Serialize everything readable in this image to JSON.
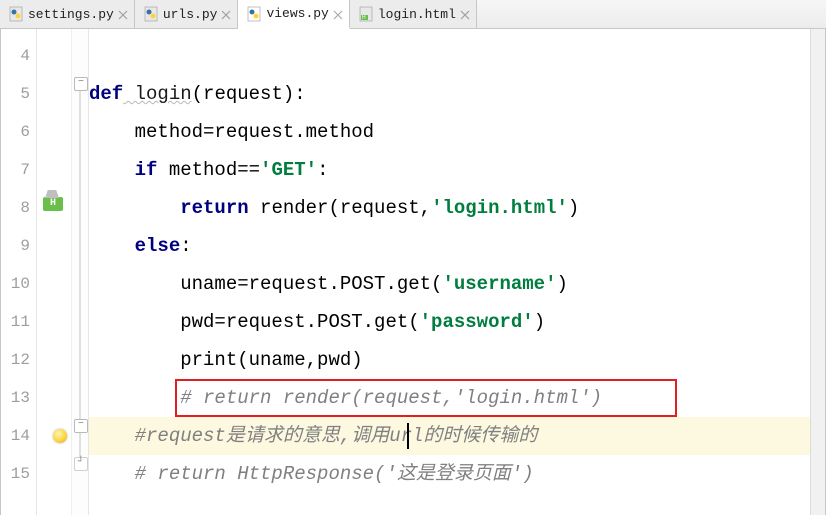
{
  "tabs": [
    {
      "label": "settings.py",
      "type": "py",
      "active": false
    },
    {
      "label": "urls.py",
      "type": "py",
      "active": false
    },
    {
      "label": "views.py",
      "type": "py",
      "active": true
    },
    {
      "label": "login.html",
      "type": "html",
      "active": false
    }
  ],
  "line_numbers": [
    "4",
    "5",
    "6",
    "7",
    "8",
    "9",
    "10",
    "11",
    "12",
    "13",
    "14",
    "15"
  ],
  "code": {
    "l5_kw1": "def",
    "l5_fn": " login",
    "l5_rest": "(request):",
    "l6": "    method=request.method",
    "l7_pre": "    ",
    "l7_kw": "if",
    "l7_mid": " method==",
    "l7_str": "'GET'",
    "l7_end": ":",
    "l8_pre": "        ",
    "l8_kw": "return",
    "l8_mid": " render(request,",
    "l8_str": "'login.html'",
    "l8_end": ")",
    "l9_pre": "    ",
    "l9_kw": "else",
    "l9_end": ":",
    "l10_pre": "        uname=request.POST.get(",
    "l10_str": "'username'",
    "l10_end": ")",
    "l11_pre": "        pwd=request.POST.get(",
    "l11_str": "'password'",
    "l11_end": ")",
    "l12": "        print(uname,pwd)",
    "l13": "        ",
    "l13_cm": "# return render(request,'login.html')",
    "l14_pre": "    ",
    "l14_cm": "#request是请求的意思,调用url的时候传输的",
    "l15_pre": "    ",
    "l15_cm": "# return HttpResponse('这是登录页面')"
  }
}
